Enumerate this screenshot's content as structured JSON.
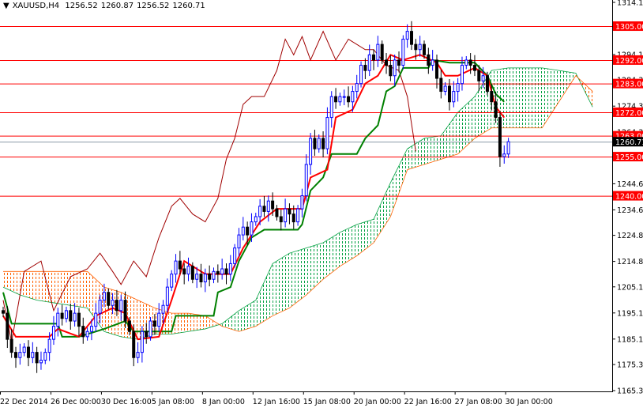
{
  "header": {
    "symbol": "XAUUSD,H4",
    "open": "1256.52",
    "high": "1260.87",
    "low": "1256.52",
    "close": "1260.71"
  },
  "colors": {
    "bull": "#0000ff",
    "bear": "#000000",
    "tenkan": "#ff0000",
    "kijun": "#008000",
    "chikou": "#a00000",
    "kumo_up": "#00a040",
    "kumo_down": "#ff6000",
    "level": "#ff0000",
    "current": "#8c9aa8"
  },
  "chart_data": {
    "type": "candlestick",
    "title": "XAUUSD,H4",
    "ylim": [
      1165.35,
      1314.1
    ],
    "y_ticks": [
      "1314.10",
      "1294.10",
      "1284.35",
      "1274.35",
      "1264.35",
      "1244.60",
      "1234.60",
      "1224.85",
      "1214.85",
      "1205.10",
      "1195.10",
      "1185.10",
      "1175.35",
      "1165.35"
    ],
    "x_ticks": [
      {
        "bar": 0,
        "label": "22 Dec 2014"
      },
      {
        "bar": 12,
        "label": "26 Dec 00:00"
      },
      {
        "bar": 24,
        "label": "30 Dec 16:00"
      },
      {
        "bar": 36,
        "label": "5 Jan 08:00"
      },
      {
        "bar": 48,
        "label": "8 Jan 00:00"
      },
      {
        "bar": 60,
        "label": "12 Jan 16:00"
      },
      {
        "bar": 72,
        "label": "15 Jan 08:00"
      },
      {
        "bar": 84,
        "label": "20 Jan 00:00"
      },
      {
        "bar": 96,
        "label": "22 Jan 16:00"
      },
      {
        "bar": 108,
        "label": "27 Jan 08:00"
      },
      {
        "bar": 120,
        "label": "30 Jan 00:00"
      }
    ],
    "closes": [
      1195,
      1185,
      1180,
      1178,
      1180,
      1182,
      1178,
      1180,
      1176,
      1177,
      1180,
      1185,
      1190,
      1195,
      1193,
      1196,
      1192,
      1195,
      1190,
      1186,
      1188,
      1190,
      1195,
      1200,
      1203,
      1198,
      1200,
      1196,
      1200,
      1192,
      1188,
      1178,
      1180,
      1188,
      1186,
      1192,
      1190,
      1195,
      1198,
      1205,
      1210,
      1215,
      1212,
      1210,
      1213,
      1208,
      1210,
      1207,
      1210,
      1208,
      1211,
      1210,
      1212,
      1210,
      1214,
      1220,
      1225,
      1228,
      1225,
      1230,
      1232,
      1236,
      1234,
      1238,
      1235,
      1232,
      1230,
      1235,
      1233,
      1230,
      1235,
      1240,
      1252,
      1262,
      1258,
      1262,
      1258,
      1270,
      1278,
      1276,
      1278,
      1278,
      1276,
      1280,
      1283,
      1290,
      1288,
      1294,
      1292,
      1298,
      1292,
      1290,
      1286,
      1292,
      1290,
      1300,
      1303,
      1298,
      1296,
      1298,
      1294,
      1290,
      1292,
      1285,
      1280,
      1282,
      1276,
      1280,
      1283,
      1290,
      1292,
      1290,
      1288,
      1284,
      1286,
      1280,
      1276,
      1270,
      1255,
      1256,
      1260.71
    ],
    "tenkan": [
      [
        0,
        1194
      ],
      [
        3,
        1186
      ],
      [
        11,
        1186
      ],
      [
        13,
        1189
      ],
      [
        18,
        1186
      ],
      [
        22,
        1194
      ],
      [
        26,
        1197
      ],
      [
        29,
        1195
      ],
      [
        32,
        1185
      ],
      [
        37,
        1186
      ],
      [
        40,
        1200
      ],
      [
        43,
        1215
      ],
      [
        48,
        1210
      ],
      [
        54,
        1210
      ],
      [
        57,
        1220
      ],
      [
        61,
        1230
      ],
      [
        65,
        1235
      ],
      [
        71,
        1235
      ],
      [
        73,
        1247
      ],
      [
        77,
        1250
      ],
      [
        79,
        1270
      ],
      [
        83,
        1273
      ],
      [
        86,
        1283
      ],
      [
        89,
        1286
      ],
      [
        92,
        1294
      ],
      [
        95,
        1292
      ],
      [
        99,
        1294
      ],
      [
        103,
        1291
      ],
      [
        105,
        1286
      ],
      [
        108,
        1286
      ],
      [
        112,
        1289
      ],
      [
        115,
        1286
      ],
      [
        117,
        1274
      ],
      [
        119,
        1270
      ]
    ],
    "kijun": [
      [
        0,
        1203
      ],
      [
        2,
        1191
      ],
      [
        13,
        1191
      ],
      [
        14,
        1186
      ],
      [
        18,
        1186
      ],
      [
        24,
        1189
      ],
      [
        29,
        1192
      ],
      [
        31,
        1188
      ],
      [
        40,
        1188
      ],
      [
        41,
        1194
      ],
      [
        50,
        1194
      ],
      [
        51,
        1203
      ],
      [
        54,
        1205
      ],
      [
        56,
        1215
      ],
      [
        59,
        1224
      ],
      [
        62,
        1227
      ],
      [
        70,
        1227
      ],
      [
        71,
        1229
      ],
      [
        73,
        1242
      ],
      [
        76,
        1247
      ],
      [
        78,
        1256
      ],
      [
        84,
        1256
      ],
      [
        86,
        1262
      ],
      [
        89,
        1267
      ],
      [
        91,
        1280
      ],
      [
        93,
        1282
      ],
      [
        95,
        1289
      ],
      [
        101,
        1289
      ],
      [
        102,
        1292
      ],
      [
        106,
        1291
      ],
      [
        112,
        1291
      ],
      [
        115,
        1286
      ],
      [
        117,
        1279
      ],
      [
        119,
        1276
      ]
    ],
    "chikou": [
      [
        0,
        1200
      ],
      [
        2,
        1184
      ],
      [
        5,
        1211
      ],
      [
        9,
        1215
      ],
      [
        12,
        1196
      ],
      [
        16,
        1209
      ],
      [
        20,
        1212
      ],
      [
        23,
        1218
      ],
      [
        26,
        1211
      ],
      [
        28,
        1206
      ],
      [
        31,
        1215
      ],
      [
        34,
        1209
      ],
      [
        37,
        1224
      ],
      [
        40,
        1236
      ],
      [
        42,
        1239
      ],
      [
        45,
        1233
      ],
      [
        48,
        1230
      ],
      [
        51,
        1239
      ],
      [
        53,
        1254
      ],
      [
        55,
        1262
      ],
      [
        57,
        1275
      ],
      [
        59,
        1278
      ],
      [
        62,
        1278
      ],
      [
        65,
        1288
      ],
      [
        67,
        1300
      ],
      [
        69,
        1294
      ],
      [
        71,
        1301
      ],
      [
        73,
        1292
      ],
      [
        76,
        1303
      ],
      [
        79,
        1292
      ],
      [
        82,
        1300
      ],
      [
        86,
        1296
      ],
      [
        88,
        1296
      ],
      [
        91,
        1290
      ],
      [
        94,
        1288
      ],
      [
        96,
        1278
      ],
      [
        98,
        1257
      ]
    ],
    "kumo": {
      "bars": [
        0,
        4,
        8,
        12,
        16,
        20,
        24,
        28,
        32,
        36,
        40,
        44,
        48,
        52,
        56,
        60,
        64,
        68,
        72,
        76,
        80,
        84,
        88,
        92,
        96,
        100,
        104,
        108,
        112,
        116,
        120,
        124,
        128,
        132,
        136,
        140
      ],
      "span_a": [
        1205,
        1202,
        1200,
        1199,
        1198,
        1197,
        1188,
        1186,
        1185,
        1187,
        1187,
        1188,
        1189,
        1191,
        1196,
        1200,
        1214,
        1218,
        1220,
        1222,
        1226,
        1229,
        1231,
        1245,
        1258,
        1262,
        1263,
        1272,
        1278,
        1288,
        1289,
        1289,
        1289,
        1288,
        1287,
        1274
      ],
      "span_b": [
        1211,
        1211,
        1211,
        1211,
        1211,
        1211,
        1205,
        1203,
        1200,
        1197,
        1195,
        1195,
        1194,
        1190,
        1188,
        1190,
        1194,
        1197,
        1202,
        1208,
        1213,
        1217,
        1222,
        1232,
        1250,
        1252,
        1254,
        1256,
        1262,
        1266,
        1266,
        1266,
        1266,
        1276,
        1286,
        1280
      ]
    },
    "levels": [
      {
        "value": 1305,
        "label": "1305.00"
      },
      {
        "value": 1292,
        "label": "1292.00"
      },
      {
        "value": 1283,
        "label": "1283.00"
      },
      {
        "value": 1272,
        "label": "1272.00"
      },
      {
        "value": 1263,
        "label": "1263.00"
      },
      {
        "value": 1255,
        "label": "1255.00"
      },
      {
        "value": 1240,
        "label": "1240.00"
      }
    ],
    "current_price": {
      "value": 1260.71,
      "label": "1260.71"
    }
  }
}
